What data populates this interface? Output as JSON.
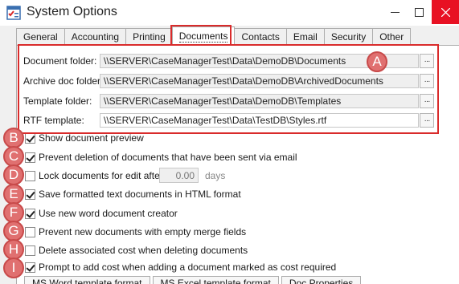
{
  "window": {
    "title": "System Options"
  },
  "tabs": [
    {
      "label": "General"
    },
    {
      "label": "Accounting"
    },
    {
      "label": "Printing"
    },
    {
      "label": "Documents"
    },
    {
      "label": "Contacts"
    },
    {
      "label": "Email"
    },
    {
      "label": "Security"
    },
    {
      "label": "Other"
    }
  ],
  "active_tab": "Documents",
  "folders": [
    {
      "label": "Document folder:",
      "value": "\\\\SERVER\\CaseManagerTest\\Data\\DemoDB\\Documents"
    },
    {
      "label": "Archive doc folder:",
      "value": "\\\\SERVER\\CaseManagerTest\\Data\\DemoDB\\ArchivedDocuments"
    },
    {
      "label": "Template folder:",
      "value": "\\\\SERVER\\CaseManagerTest\\Data\\DemoDB\\Templates"
    },
    {
      "label": "RTF template:",
      "value": "\\\\SERVER\\CaseManagerTest\\Data\\TestDB\\Styles.rtf"
    }
  ],
  "browse_label": "···",
  "options": [
    {
      "label": "Show document preview",
      "checked": true
    },
    {
      "label": "Prevent deletion of documents that have been sent via email",
      "checked": true
    },
    {
      "label": "Lock documents for edit after",
      "checked": false
    },
    {
      "label": "Save formatted text documents in HTML format",
      "checked": true
    },
    {
      "label": "Use new word document creator",
      "checked": true
    },
    {
      "label": "Prevent new documents with empty merge fields",
      "checked": false
    },
    {
      "label": "Delete associated cost when deleting documents",
      "checked": false
    },
    {
      "label": "Prompt to add cost when adding a document marked as cost required",
      "checked": true
    }
  ],
  "lock_days": {
    "value": "0.00",
    "unit": "days"
  },
  "badges": [
    "A",
    "B",
    "C",
    "D",
    "E",
    "F",
    "G",
    "H",
    "I"
  ],
  "bottom_tabs": [
    {
      "label": "MS Word template format"
    },
    {
      "label": "MS Excel template format"
    },
    {
      "label": "Doc Properties"
    }
  ],
  "colors": {
    "highlight": "#d92b2b",
    "badge": "#e07070",
    "close": "#e81123"
  },
  "icons": {
    "app": "checklist-icon",
    "minimize": "minimize-icon",
    "maximize": "maximize-icon",
    "close": "close-icon"
  }
}
